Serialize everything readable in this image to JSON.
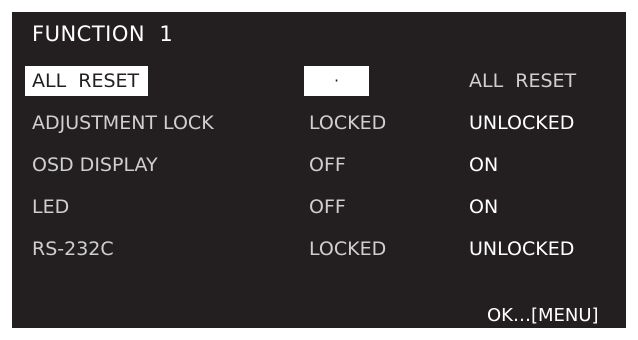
{
  "osd": {
    "title": "FUNCTION  1",
    "rows": [
      {
        "label": "ALL  RESET",
        "value_a": "·",
        "value_b": "ALL  RESET"
      },
      {
        "label": "ADJUSTMENT LOCK",
        "value_a": "LOCKED",
        "value_b": "UNLOCKED"
      },
      {
        "label": "OSD DISPLAY",
        "value_a": "OFF",
        "value_b": "ON"
      },
      {
        "label": "LED",
        "value_a": "OFF",
        "value_b": "ON"
      },
      {
        "label": "RS-232C",
        "value_a": "LOCKED",
        "value_b": "UNLOCKED"
      }
    ],
    "footer": "OK…[MENU]",
    "colors": {
      "background": "#231f20",
      "highlight": "#ffffff",
      "text": "#ffffff",
      "dim_text": "#cfcfcf"
    }
  }
}
